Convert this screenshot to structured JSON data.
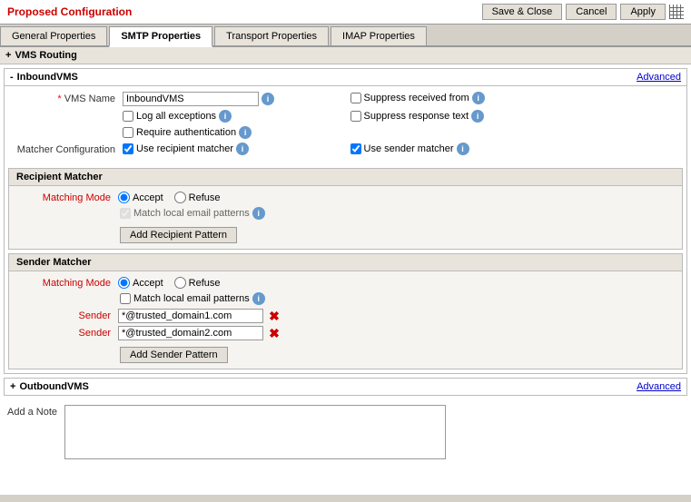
{
  "titleBar": {
    "title": "Proposed Configuration",
    "buttons": {
      "saveClose": "Save & Close",
      "cancel": "Cancel",
      "apply": "Apply"
    }
  },
  "tabs": [
    {
      "label": "General Properties",
      "active": false
    },
    {
      "label": "SMTP Properties",
      "active": true
    },
    {
      "label": "Transport Properties",
      "active": false
    },
    {
      "label": "IMAP Properties",
      "active": false
    }
  ],
  "vmsRouting": {
    "label": "VMS Routing"
  },
  "inboundVMS": {
    "title": "InboundVMS",
    "advancedLink": "Advanced",
    "vmsNameLabel": "VMS Name",
    "vmsNameValue": "InboundVMS",
    "logAllExceptions": "Log all exceptions",
    "requireAuthentication": "Require authentication",
    "suppressReceivedFrom": "Suppress received from",
    "suppressResponseText": "Suppress response text",
    "matcherConfiguration": "Matcher Configuration",
    "useRecipientMatcher": "Use recipient matcher",
    "useSenderMatcher": "Use sender matcher"
  },
  "recipientMatcher": {
    "title": "Recipient Matcher",
    "matchingModeLabel": "Matching Mode",
    "acceptLabel": "Accept",
    "refuseLabel": "Refuse",
    "matchLocalEmailPatterns": "Match local email patterns",
    "addPatternBtn": "Add Recipient Pattern"
  },
  "senderMatcher": {
    "title": "Sender Matcher",
    "matchingModeLabel": "Matching Mode",
    "acceptLabel": "Accept",
    "refuseLabel": "Refuse",
    "matchLocalEmailPatterns": "Match local email patterns",
    "senders": [
      {
        "value": "*@trusted_domain1.com"
      },
      {
        "value": "*@trusted_domain2.com"
      }
    ],
    "senderLabel": "Sender",
    "addPatternBtn": "Add Sender Pattern"
  },
  "outboundVMS": {
    "title": "OutboundVMS",
    "advancedLink": "Advanced"
  },
  "noteSection": {
    "label": "Add a Note",
    "placeholder": ""
  }
}
